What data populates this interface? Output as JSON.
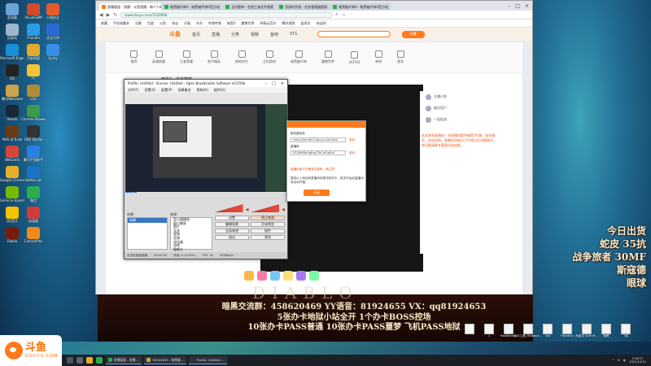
{
  "desktop_icons_col1": [
    {
      "label": "此电脑",
      "icon": "computer-icon",
      "color": "#6aa3d6"
    },
    {
      "label": "回收站",
      "icon": "recycle-bin-icon",
      "color": "#9db7cc"
    },
    {
      "label": "Microsoft Edge",
      "icon": "edge-icon",
      "color": "#1b8fd6"
    },
    {
      "label": "QQ",
      "icon": "qq-icon",
      "color": "#222"
    },
    {
      "label": "腾讯WeGame",
      "icon": "wegame-icon",
      "color": "#caa34a"
    },
    {
      "label": "Steam",
      "icon": "steam-icon",
      "color": "#1b2838"
    },
    {
      "label": "Path of Exile",
      "icon": "poe-icon",
      "color": "#6b3a17"
    },
    {
      "label": "WeGame",
      "icon": "wegame2-icon",
      "color": "#d4483a"
    },
    {
      "label": "Google Chrome",
      "icon": "chrome-icon",
      "color": "#e4b02a"
    },
    {
      "label": "GeForce Experience",
      "icon": "geforce-icon",
      "color": "#76b900"
    },
    {
      "label": "QQ音乐",
      "icon": "qqmusic-icon",
      "color": "#f4c300"
    },
    {
      "label": "Diablo",
      "icon": "diablo-icon",
      "color": "#7a1b10"
    }
  ],
  "desktop_icons_col2": [
    {
      "label": "VisualGBM",
      "icon": "app-icon",
      "color": "#d24a2a"
    },
    {
      "label": "Thunder",
      "icon": "thunder-icon",
      "color": "#2a9be4"
    },
    {
      "label": "百度网盘",
      "icon": "baidu-disk-icon",
      "color": "#e3a92c"
    },
    {
      "label": "YY",
      "icon": "yy-icon",
      "color": "#f6c533"
    },
    {
      "label": "LOL",
      "icon": "lol-icon",
      "color": "#b08c3a"
    },
    {
      "label": "Chrome Browser",
      "icon": "chrome2-icon",
      "color": "#3a9b4c"
    },
    {
      "label": "OBS Studio",
      "icon": "obs-icon",
      "color": "#333"
    },
    {
      "label": "腾讯手游助手",
      "icon": "game-helper-icon",
      "color": "#2a7fe4"
    },
    {
      "label": "Battle.net",
      "icon": "battlenet-icon",
      "color": "#1a73c8"
    },
    {
      "label": "微信",
      "icon": "wechat-icon",
      "color": "#2aae4c"
    },
    {
      "label": "加速器",
      "icon": "accelerator-icon",
      "color": "#d43a3a"
    },
    {
      "label": "ComicsPlus",
      "icon": "comics-icon",
      "color": "#f08a1a"
    }
  ],
  "desktop_icons_col3": [
    {
      "label": "火绒安全",
      "icon": "shield-icon",
      "color": "#e45a2a"
    },
    {
      "label": "优化大师",
      "icon": "optimize-icon",
      "color": "#2a6ad4"
    },
    {
      "label": "Uplay",
      "icon": "uplay-icon",
      "color": "#3a8ee4"
    }
  ],
  "browser": {
    "tabs": [
      {
        "label": "直播画面 - 直播 - 斗鱼直播 - 每个人的直播平台",
        "color": "#ff7a1a",
        "active": true
      },
      {
        "label": "暗黑破坏神3 - 暗黑破坏神3官方站",
        "color": "#2aae4c",
        "active": false
      },
      {
        "label": "全问题单 - 在线工具文件搜索",
        "color": "#2aae4c",
        "active": false
      },
      {
        "label": "资源的列表 - 任务管理器搜索",
        "color": "#2aae4c",
        "active": false
      },
      {
        "label": "暗黑破坏神3 - 暗黑破坏神3官方站",
        "color": "#2aae4c",
        "active": false
      }
    ],
    "url": "www.douyu.com/5328968",
    "bookmarks": [
      "收藏",
      "手机收藏夹",
      "谷歌",
      "百度",
      "斗鱼",
      "淘宝",
      "天猫",
      "京东",
      "哔哩哔哩",
      "暗黑3",
      "魔兽世界",
      "网易云音乐",
      "腾讯视频",
      "爱奇艺",
      "淘宝网"
    ],
    "site": {
      "logo": "斗鱼",
      "nav": [
        "首页",
        "直播",
        "分类",
        "视频",
        "鱼吧",
        "ST1"
      ],
      "header_btn": "开播",
      "categories": [
        "推荐",
        "英雄联盟",
        "王者荣耀",
        "和平精英",
        "绝地求生",
        "主机游戏",
        "暗黑破坏神",
        "魔兽世界",
        "DOTA2",
        "单机",
        "更多"
      ],
      "room_title": "暗黑3 · 追逐梦想",
      "side_users": [
        "主播小鱼",
        "精灵用户",
        "一起加油"
      ],
      "notice": "欢迎来到直播间！本直播间提供暗黑3代练、陪玩服务，欢迎咨询。直播时间每天下午两点至凌晨两点，有问题请联系管理员或加群。"
    }
  },
  "obs": {
    "title": "Profile: Untitled - Scenes: Untitled - Open Broadcaster Software v0.659b",
    "menu": [
      "文件(F)",
      "设置(S)",
      "配置(P)",
      "场景集合",
      "帮助(H)",
      "插件(G)"
    ],
    "source_tab": "场景",
    "dock_scenes_label": "场景:",
    "dock_sources_label": "来源:",
    "scenes": [
      "场景"
    ],
    "sources": [
      "显示器捕获",
      "窗口捕获",
      "图片",
      "文本",
      "视频",
      "音频",
      "浏览器",
      "游戏",
      "摄像头"
    ],
    "controls": [
      {
        "label": "设置",
        "primary": false
      },
      {
        "label": "停止串流",
        "primary": true
      },
      {
        "label": "编辑场景",
        "primary": false
      },
      {
        "label": "开始预览",
        "primary": false
      },
      {
        "label": "全局来源",
        "primary": false
      },
      {
        "label": "插件",
        "primary": false
      },
      {
        "label": "退出",
        "primary": false
      },
      {
        "label": "预览",
        "primary": false
      }
    ],
    "status": [
      "无法连接服务器",
      "00:00:32",
      "丢帧: 0 (0.00%)",
      "FPS: 30",
      "4598kb/s"
    ]
  },
  "dialog": {
    "server_label": "服务器地址",
    "server_value": "rtmp://sendtc3.douyu.com/live",
    "key_label": "直播码",
    "key_value": "5328968r0gRrgTTuCoiGqEaY",
    "copy_label": "复制",
    "warn": "直播码每次开播将会更新，请注意！",
    "note": "复制以上地址和直播码到推流软件中，推流开始后直播间将自动开播。",
    "button": "关闭"
  },
  "overlay_right": [
    "今日出货",
    "蛇皮 35抗",
    "战争旅者 30MF",
    "斯寇德",
    "眼球"
  ],
  "overlay_bottom": [
    "暗黑交流群：458620469 YY语音：81924655 VX：qq81924653",
    "5张办卡地狱小站全开 1个办卡BOSS控场",
    "10张办卡PASS普通 10张办卡PASS噩梦 飞机PASS地狱"
  ],
  "diablo_logo": "DIABLO",
  "douyu": {
    "cn": "斗鱼",
    "en": "DOUYU.COM"
  },
  "right_icons": [
    {
      "label": "",
      "icon": "folder-icon"
    },
    {
      "label": "1",
      "icon": "file-icon"
    },
    {
      "label": "ReadShells",
      "icon": "file-icon"
    },
    {
      "label": "[D3工具] Ribbbon...",
      "icon": "file-icon"
    },
    {
      "label": "444",
      "icon": "file-icon"
    },
    {
      "label": "Filtration",
      "icon": "filter-icon"
    },
    {
      "label": "西游记 Safe M...",
      "icon": "file-icon"
    },
    {
      "label": "暗黑",
      "icon": "file-icon"
    },
    {
      "label": "飞机",
      "icon": "file-icon"
    }
  ],
  "taskbar": {
    "apps": [
      {
        "label": "直播画面 - 直播 ...",
        "color": "#2aae4c"
      },
      {
        "label": "9050460S - 暗黑破...",
        "color": "#caa34a"
      },
      {
        "label": "Profile: Untitled ...",
        "color": "#333"
      }
    ],
    "time": "5:38:27",
    "date": "2021/10/11"
  }
}
